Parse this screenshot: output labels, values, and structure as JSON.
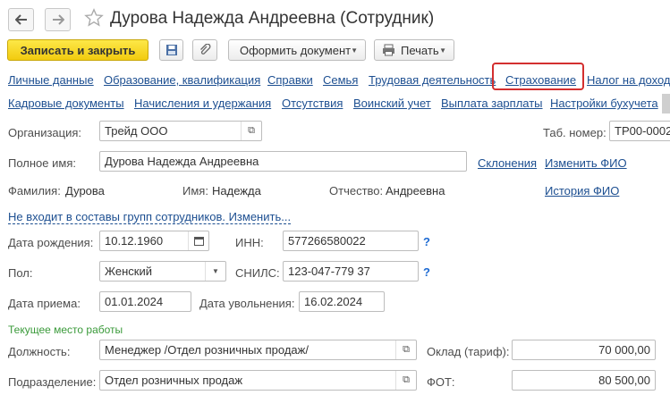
{
  "window": {
    "title": "Дурова Надежда Андреевна (Сотрудник)"
  },
  "toolbar": {
    "save_close": "Записать и закрыть",
    "create_document": "Оформить документ",
    "print": "Печать"
  },
  "tabs_row1": [
    "Личные данные",
    "Образование, квалификация",
    "Справки",
    "Семья",
    "Трудовая деятельность",
    "Страхование",
    "Налог на доход"
  ],
  "tabs_row2": [
    "Кадровые документы",
    "Начисления и удержания",
    "Отсутствия",
    "Воинский учет",
    "Выплата зарплаты",
    "Настройки бухучета"
  ],
  "form": {
    "organization_label": "Организация:",
    "organization_value": "Трейд ООО",
    "tab_number_label": "Таб. номер:",
    "tab_number_value": "ТР00-0002",
    "full_name_label": "Полное имя:",
    "full_name_value": "Дурова Надежда Андреевна",
    "declensions_link": "Склонения",
    "change_name_link": "Изменить ФИО",
    "surname_label": "Фамилия:",
    "surname_value": "Дурова",
    "name_label": "Имя:",
    "name_value": "Надежда",
    "patronymic_label": "Отчество:",
    "patronymic_value": "Андреевна",
    "name_history_link": "История ФИО",
    "groups_link": "Не входит в составы групп сотрудников. Изменить...",
    "birth_date_label": "Дата рождения:",
    "birth_date_value": "10.12.1960",
    "inn_label": "ИНН:",
    "inn_value": "577266580022",
    "gender_label": "Пол:",
    "gender_value": "Женский",
    "snils_label": "СНИЛС:",
    "snils_value": "123-047-779 37",
    "hire_date_label": "Дата приема:",
    "hire_date_value": "01.01.2024",
    "dismissal_date_label": "Дата увольнения:",
    "dismissal_date_value": "16.02.2024",
    "help_mark": "?"
  },
  "workplace": {
    "section_title": "Текущее место работы",
    "position_label": "Должность:",
    "position_value": "Менеджер /Отдел розничных продаж/",
    "salary_label": "Оклад (тариф):",
    "salary_value": "70 000,00",
    "department_label": "Подразделение:",
    "department_value": "Отдел розничных продаж",
    "fot_label": "ФОТ:",
    "fot_value": "80 500,00"
  },
  "colors": {
    "link": "#1d4f91",
    "primary_button": "#f2cb0f",
    "highlight": "#d32f2f",
    "section_title": "#3a9a3a"
  }
}
